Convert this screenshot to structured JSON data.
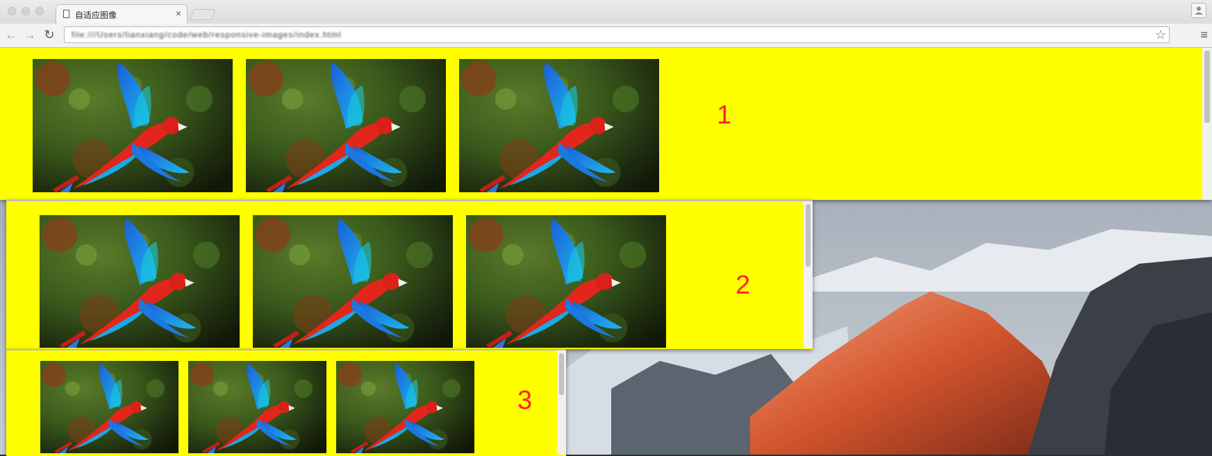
{
  "browser": {
    "tab_title": "自适应图像",
    "tab_close": "×",
    "url_text": "file:///Users/lianxiang/code/web/responsive-images/index.html",
    "star_icon": "☆",
    "menu_icon": "≡",
    "back_icon": "←",
    "forward_icon": "→",
    "reload_icon": "↻",
    "profile_icon": "person-icon"
  },
  "panels": [
    {
      "label": "1",
      "image_count": 3
    },
    {
      "label": "2",
      "image_count": 3
    },
    {
      "label": "3",
      "image_count": 3
    }
  ],
  "colors": {
    "page_background": "#ffff00",
    "number_color": "#ff2222"
  }
}
